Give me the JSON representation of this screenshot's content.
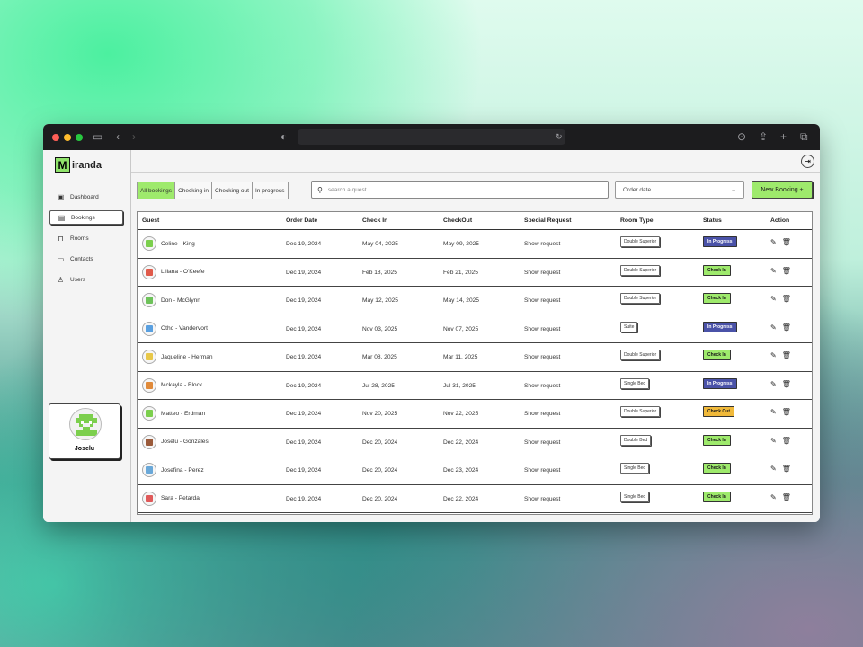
{
  "browser": {
    "traffic_lights": [
      "#ff5f57",
      "#febc2e",
      "#28c840"
    ]
  },
  "app": {
    "logo_letter": "M",
    "logo_rest": "iranda"
  },
  "sidebar": {
    "items": [
      {
        "label": "Dashboard",
        "icon": "dashboard-icon",
        "active": false
      },
      {
        "label": "Bookings",
        "icon": "calendar-icon",
        "active": true
      },
      {
        "label": "Rooms",
        "icon": "lock-icon",
        "active": false
      },
      {
        "label": "Contacts",
        "icon": "contacts-icon",
        "active": false
      },
      {
        "label": "Users",
        "icon": "user-icon",
        "active": false
      }
    ],
    "user_name": "Joselu"
  },
  "toolbar": {
    "filters": [
      "All bookings",
      "Checking in",
      "Checking out",
      "In progress"
    ],
    "active_filter": "All bookings",
    "search_placeholder": "search a quest..",
    "order_label": "Order date",
    "new_booking_label": "New Booking +"
  },
  "table": {
    "columns": [
      "Guest",
      "Order Date",
      "Check In",
      "CheckOut",
      "Special Request",
      "Room Type",
      "Status",
      "Action"
    ],
    "rows": [
      {
        "guest": "Celine - King",
        "order": "Dec 19, 2024",
        "in": "May 04, 2025",
        "out": "May 09, 2025",
        "request": "Show request",
        "room": "Double Superior",
        "status": "In Progress",
        "avatar": "#7ccf4d"
      },
      {
        "guest": "Liliana - O'Keefe",
        "order": "Dec 19, 2024",
        "in": "Feb 18, 2025",
        "out": "Feb 21, 2025",
        "request": "Show request",
        "room": "Double Superior",
        "status": "Check In",
        "avatar": "#e05a4a"
      },
      {
        "guest": "Don - McGlynn",
        "order": "Dec 19, 2024",
        "in": "May 12, 2025",
        "out": "May 14, 2025",
        "request": "Show request",
        "room": "Double Superior",
        "status": "Check In",
        "avatar": "#6ec25a"
      },
      {
        "guest": "Otho - Vandervort",
        "order": "Dec 19, 2024",
        "in": "Nov 03, 2025",
        "out": "Nov 07, 2025",
        "request": "Show request",
        "room": "Suite",
        "status": "In Progress",
        "avatar": "#5aa0e0"
      },
      {
        "guest": "Jaqueline - Herman",
        "order": "Dec 19, 2024",
        "in": "Mar 08, 2025",
        "out": "Mar 11, 2025",
        "request": "Show request",
        "room": "Double Superior",
        "status": "Check In",
        "avatar": "#e8c84a"
      },
      {
        "guest": "Mckayla - Block",
        "order": "Dec 19, 2024",
        "in": "Jul 28, 2025",
        "out": "Jul 31, 2025",
        "request": "Show request",
        "room": "Single Bed",
        "status": "In Progress",
        "avatar": "#e08a3a"
      },
      {
        "guest": "Matteo - Erdman",
        "order": "Dec 19, 2024",
        "in": "Nov 20, 2025",
        "out": "Nov 22, 2025",
        "request": "Show request",
        "room": "Double Superior",
        "status": "Check Out",
        "avatar": "#7ccf4d"
      },
      {
        "guest": "Joselu - Gonzales",
        "order": "Dec 19, 2024",
        "in": "Dec 20, 2024",
        "out": "Dec 22, 2024",
        "request": "Show request",
        "room": "Double Bed",
        "status": "Check In",
        "avatar": "#9a5a3a"
      },
      {
        "guest": "Josefina - Perez",
        "order": "Dec 19, 2024",
        "in": "Dec 20, 2024",
        "out": "Dec 23, 2024",
        "request": "Show request",
        "room": "Single Bed",
        "status": "Check In",
        "avatar": "#6aa8d8"
      },
      {
        "guest": "Sara - Petarda",
        "order": "Dec 19, 2024",
        "in": "Dec 20, 2024",
        "out": "Dec 22, 2024",
        "request": "Show request",
        "room": "Single Bed",
        "status": "Check In",
        "avatar": "#e05a5a"
      }
    ]
  },
  "status_colors": {
    "In Progress": {
      "bg": "#4a52a8",
      "fg": "#ffffff"
    },
    "Check In": {
      "bg": "#9eea6c",
      "fg": "#1a1a1a"
    },
    "Check Out": {
      "bg": "#f0b93a",
      "fg": "#1a1a1a"
    }
  }
}
